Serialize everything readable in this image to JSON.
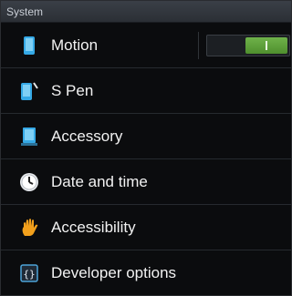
{
  "section": {
    "title": "System"
  },
  "items": [
    {
      "label": "Motion",
      "icon": "phone-motion-icon"
    },
    {
      "label": "S Pen",
      "icon": "s-pen-icon"
    },
    {
      "label": "Accessory",
      "icon": "accessory-icon"
    },
    {
      "label": "Date and time",
      "icon": "clock-icon"
    },
    {
      "label": "Accessibility",
      "icon": "hand-icon"
    },
    {
      "label": "Developer options",
      "icon": "braces-icon"
    }
  ],
  "motion_toggle": {
    "state": "on",
    "color": "#5ea33a"
  },
  "colors": {
    "background": "#0b0c0e",
    "accent_blue": "#35a9e6",
    "hand_orange": "#f2a01c"
  }
}
